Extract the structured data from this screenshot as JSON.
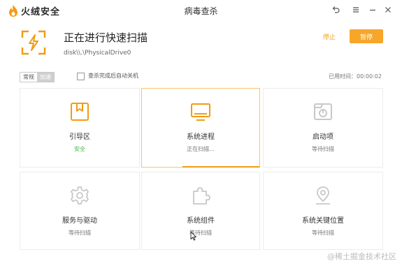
{
  "app": {
    "name": "火绒安全",
    "window_title": "病毒查杀"
  },
  "header": {
    "title": "正在进行快速扫描",
    "path": "disk\\\\.\\PhysicalDrive0",
    "stop_label": "停止",
    "pause_label": "暂停"
  },
  "options": {
    "mode_normal": "常规",
    "mode_fast": "加速",
    "shutdown_label": "查杀完成后自动关机",
    "elapsed_label": "已用时间：00:00:02"
  },
  "cards": [
    {
      "title": "引导区",
      "status": "安全",
      "icon": "bookmark-icon"
    },
    {
      "title": "系统进程",
      "status": "正在扫描...",
      "icon": "monitor-icon"
    },
    {
      "title": "启动项",
      "status": "等待扫描",
      "icon": "startup-icon"
    },
    {
      "title": "服务与驱动",
      "status": "等待扫描",
      "icon": "gear-icon"
    },
    {
      "title": "系统组件",
      "status": "等待扫描",
      "icon": "puzzle-icon"
    },
    {
      "title": "系统关键位置",
      "status": "等待扫描",
      "icon": "location-icon"
    }
  ],
  "watermark": "@稀土掘金技术社区",
  "colors": {
    "accent": "#f39c12",
    "safe": "#4caf50",
    "icon_gray": "#c8c8c8"
  }
}
